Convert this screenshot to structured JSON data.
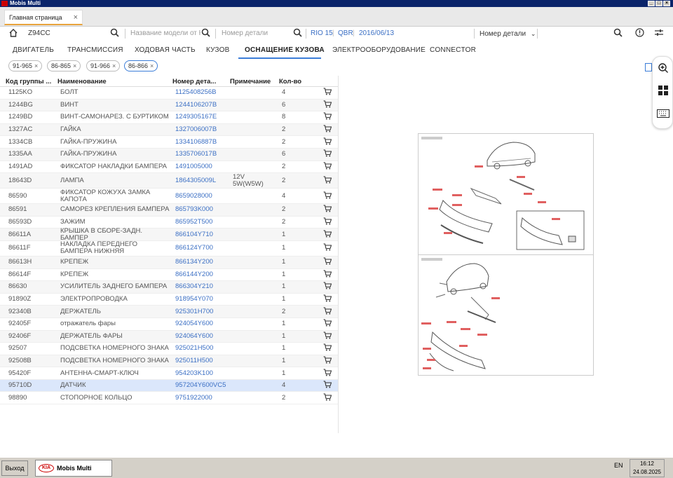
{
  "window": {
    "title": "Mobis Multi"
  },
  "tabs": [
    {
      "label": "Главная страница"
    }
  ],
  "search": {
    "vin_value": "Z94CC",
    "model_placeholder": "Название модели от Ка",
    "part_placeholder": "Номер детали",
    "model_info": [
      "RIO 15",
      "QBR",
      "2016/06/13"
    ],
    "part_dropdown": "Номер детали"
  },
  "categories": [
    "ДВИГАТЕЛЬ",
    "ТРАНСМИССИЯ",
    "ХОДОВАЯ ЧАСТЬ",
    "КУЗОВ",
    "ОСНАЩЕНИЕ КУЗОВА",
    "ЭЛЕКТРООБОРУДОВАНИЕ",
    "CONNECTOR"
  ],
  "active_category": "ОСНАЩЕНИЕ КУЗОВА",
  "chips": [
    "91-965",
    "86-865",
    "91-966",
    "86-866"
  ],
  "table": {
    "headers": [
      "Код группы ...",
      "Наименование",
      "Номер дета...",
      "Примечание",
      "Кол-во"
    ],
    "rows": [
      {
        "code": "1125KO",
        "name": "БОЛТ",
        "part": "1125408256B",
        "note": "",
        "qty": "4"
      },
      {
        "code": "1244BG",
        "name": "ВИНТ",
        "part": "1244106207B",
        "note": "",
        "qty": "6"
      },
      {
        "code": "1249BD",
        "name": "ВИНТ-САМОНАРЕЗ. С БУРТИКОМ",
        "part": "1249305167E",
        "note": "",
        "qty": "8"
      },
      {
        "code": "1327AC",
        "name": "ГАЙКА",
        "part": "1327006007B",
        "note": "",
        "qty": "2"
      },
      {
        "code": "1334CB",
        "name": "ГАЙКА-ПРУЖИНА",
        "part": "1334106887B",
        "note": "",
        "qty": "2"
      },
      {
        "code": "1335AA",
        "name": "ГАЙКА-ПРУЖИНА",
        "part": "1335706017B",
        "note": "",
        "qty": "6"
      },
      {
        "code": "1491AD",
        "name": "ФИКСАТОР НАКЛАДКИ БАМПЕРА",
        "part": "1491005000",
        "note": "",
        "qty": "2"
      },
      {
        "code": "18643D",
        "name": "ЛАМПА",
        "part": "1864305009L",
        "note": "12V 5W(W5W)",
        "qty": "2"
      },
      {
        "code": "86590",
        "name": "ФИКСАТОР КОЖУХА ЗАМКА КАПОТА",
        "part": "8659028000",
        "note": "",
        "qty": "4"
      },
      {
        "code": "86591",
        "name": "САМОРЕЗ КРЕПЛЕНИЯ БАМПЕРА",
        "part": "865793K000",
        "note": "",
        "qty": "2"
      },
      {
        "code": "86593D",
        "name": "ЗАЖИМ",
        "part": "865952T500",
        "note": "",
        "qty": "2"
      },
      {
        "code": "86611A",
        "name": "КРЫШКА В СБОРЕ-ЗАДН. БАМПЕР",
        "part": "866104Y710",
        "note": "",
        "qty": "1"
      },
      {
        "code": "86611F",
        "name": "НАКЛАДКА ПЕРЕДНЕГО БАМПЕРА НИЖНЯЯ",
        "part": "866124Y700",
        "note": "",
        "qty": "1"
      },
      {
        "code": "86613H",
        "name": "КРЕПЕЖ",
        "part": "866134Y200",
        "note": "",
        "qty": "1"
      },
      {
        "code": "86614F",
        "name": "КРЕПЕЖ",
        "part": "866144Y200",
        "note": "",
        "qty": "1"
      },
      {
        "code": "86630",
        "name": "УСИЛИТЕЛЬ ЗАДНЕГО БАМПЕРА",
        "part": "866304Y210",
        "note": "",
        "qty": "1"
      },
      {
        "code": "91890Z",
        "name": "ЭЛЕКТРОПРОВОДКА",
        "part": "918954Y070",
        "note": "",
        "qty": "1"
      },
      {
        "code": "92340B",
        "name": "ДЕРЖАТЕЛЬ",
        "part": "925301H700",
        "note": "",
        "qty": "2"
      },
      {
        "code": "92405F",
        "name": "отражатель фары",
        "part": "924054Y600",
        "note": "",
        "qty": "1"
      },
      {
        "code": "92406F",
        "name": "ДЕРЖАТЕЛЬ ФАРЫ",
        "part": "924064Y600",
        "note": "",
        "qty": "1"
      },
      {
        "code": "92507",
        "name": "ПОДСВЕТКА НОМЕРНОГО ЗНАКА",
        "part": "925021H500",
        "note": "",
        "qty": "1"
      },
      {
        "code": "92508B",
        "name": "ПОДСВЕТКА НОМЕРНОГО ЗНАКА",
        "part": "925011H500",
        "note": "",
        "qty": "1"
      },
      {
        "code": "95420F",
        "name": "АНТЕННА-СМАРТ-КЛЮЧ",
        "part": "954203K100",
        "note": "",
        "qty": "1"
      },
      {
        "code": "95710D",
        "name": "ДАТЧИК",
        "part": "957204Y600VC5",
        "note": "",
        "qty": "4"
      },
      {
        "code": "98890",
        "name": "СТОПОРНОЕ КОЛЬЦО",
        "part": "9751922000",
        "note": "",
        "qty": "2"
      }
    ]
  },
  "taskbar": {
    "exit_label": "Выход",
    "app_label": "Mobis Multi",
    "kia": "KIA",
    "lang": "EN",
    "time": "16:12",
    "date": "24.08.2025"
  },
  "colors": {
    "accent": "#3b7dd8",
    "link": "#3b6fc4",
    "tab_accent": "#e8a33c",
    "highlight_row": "#dbe7fb"
  }
}
